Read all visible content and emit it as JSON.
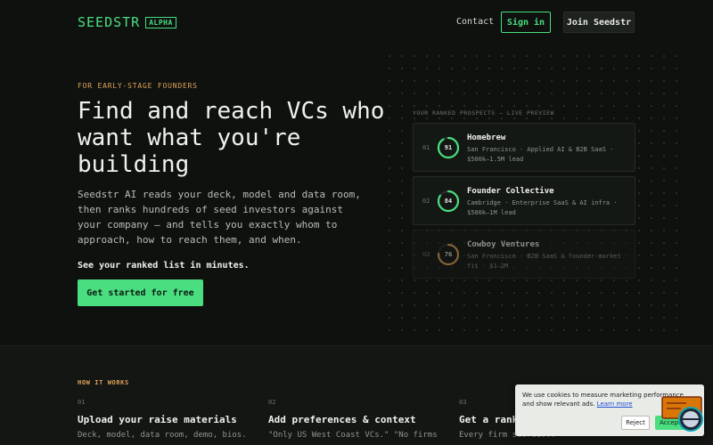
{
  "header": {
    "logo": "SEEDSTR",
    "badge": "ALPHA",
    "contact": "Contact",
    "sign_in": "Sign in",
    "join": "Join Seedstr"
  },
  "hero": {
    "eyebrow": "FOR EARLY-STAGE FOUNDERS",
    "title": "Find and reach VCs who want what you're building",
    "description": "Seedstr AI reads your deck, model and data room, then ranks hundreds of seed investors against your company — and tells you exactly whom to approach, how to reach them, and when.",
    "subline": "See your ranked list in minutes.",
    "cta": "Get started for free"
  },
  "prospects": {
    "label": "YOUR RANKED PROSPECTS — LIVE PREVIEW",
    "items": [
      {
        "rank": "01",
        "score": "91",
        "score_value": 91,
        "name": "Homebrew",
        "meta": "San Francisco · Applied AI & B2B SaaS · $500k–1.5M lead",
        "color": "#4ade80"
      },
      {
        "rank": "02",
        "score": "84",
        "score_value": 84,
        "name": "Founder Collective",
        "meta": "Cambridge · Enterprise SaaS & AI infra · $500k–1M lead",
        "color": "#4ade80"
      },
      {
        "rank": "03",
        "score": "76",
        "score_value": 76,
        "name": "Cowboy Ventures",
        "meta": "San Francisco · B2B SaaS & founder-market fit · $1–2M",
        "color": "#e0a458"
      }
    ]
  },
  "how": {
    "label": "HOW IT WORKS",
    "steps": [
      {
        "num": "01",
        "title": "Upload your raise materials",
        "desc": "Deck, model, data room, demo, bios."
      },
      {
        "num": "02",
        "title": "Add preferences & context",
        "desc": "\"Only US West Coast VCs.\" \"No firms"
      },
      {
        "num": "03",
        "title": "Get a rank",
        "desc": "Every firm scored..."
      }
    ]
  },
  "cookie": {
    "text": "We use cookies to measure marketing performance and show relevant ads.",
    "link": "Learn more",
    "reject": "Reject",
    "accept": "Accept"
  }
}
